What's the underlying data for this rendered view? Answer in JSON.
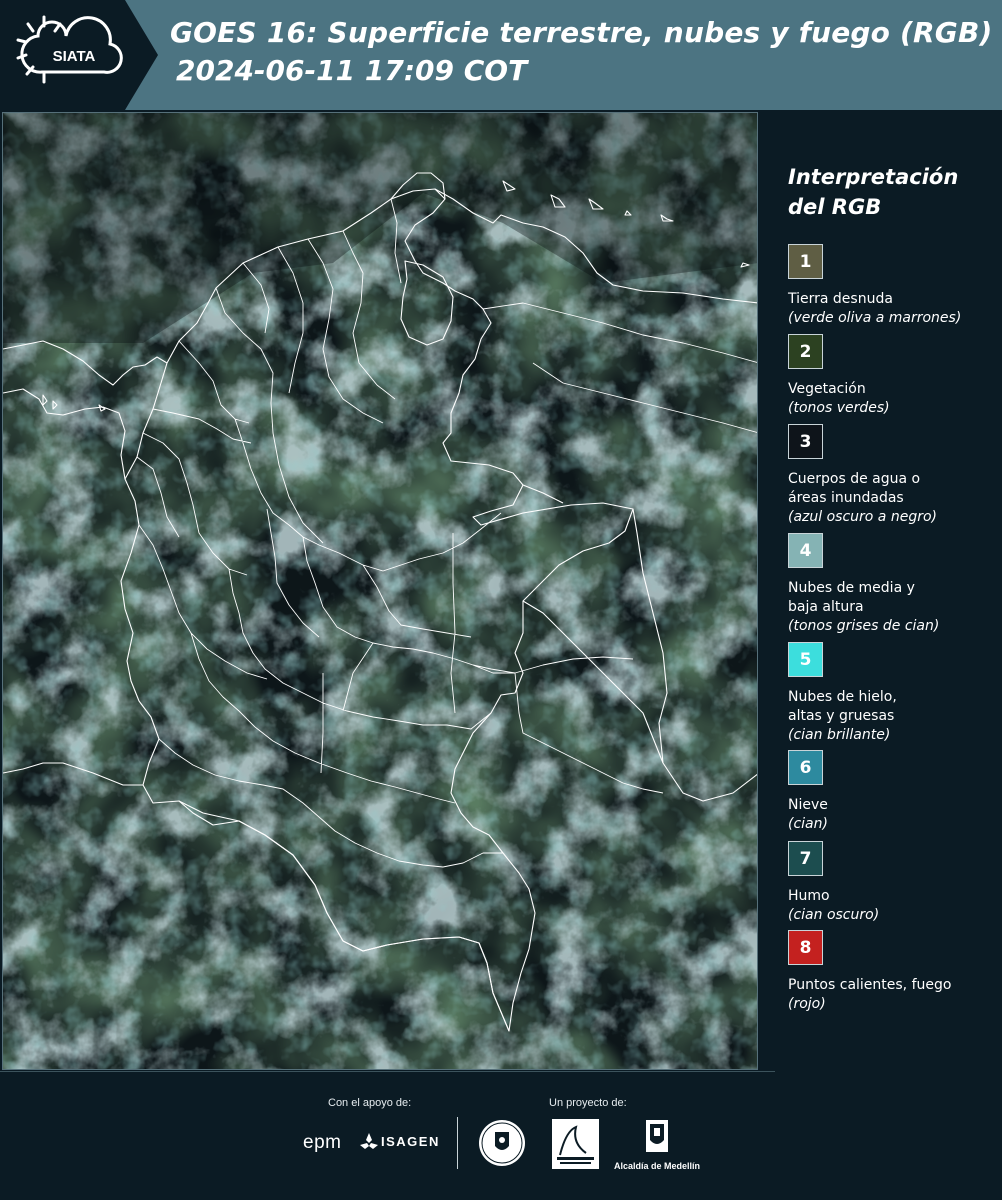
{
  "header": {
    "logo_text": "SIATA",
    "title": "GOES 16: Superficie terrestre, nubes y fuego (RGB)",
    "datetime": "2024-06-11 17:09 COT"
  },
  "legend": {
    "title": "Interpretación del RGB",
    "items": [
      {
        "number": "1",
        "label": "Tierra desnuda",
        "note": "(verde oliva a marrones)",
        "color": "#5f5e44"
      },
      {
        "number": "2",
        "label": "Vegetación",
        "note": "(tonos verdes)",
        "color": "#2c4121"
      },
      {
        "number": "3",
        "label": "Cuerpos de agua o\náreas inundadas",
        "note": "(azul oscuro a negro)",
        "color": "#0e141a"
      },
      {
        "number": "4",
        "label": "Nubes de media y\nbaja altura",
        "note": "(tonos grises de cian)",
        "color": "#85b3b4"
      },
      {
        "number": "5",
        "label": "Nubes de hielo,\naltas y gruesas",
        "note": "(cian brillante)",
        "color": "#3cdedd"
      },
      {
        "number": "6",
        "label": "Nieve",
        "note": "(cian)",
        "color": "#2d8a9f"
      },
      {
        "number": "7",
        "label": "Humo",
        "note": "(cian oscuro)",
        "color": "#1c4d4f"
      },
      {
        "number": "8",
        "label": "Puntos calientes, fuego",
        "note": "(rojo)",
        "color": "#c4211f"
      }
    ]
  },
  "footer": {
    "support_label": "Con el apoyo de:",
    "project_label": "Un proyecto de:",
    "sponsors": [
      "epm",
      "ISAGEN"
    ],
    "partners": [
      "Área Metropolitana",
      "Alcaldía de Medellín"
    ]
  }
}
